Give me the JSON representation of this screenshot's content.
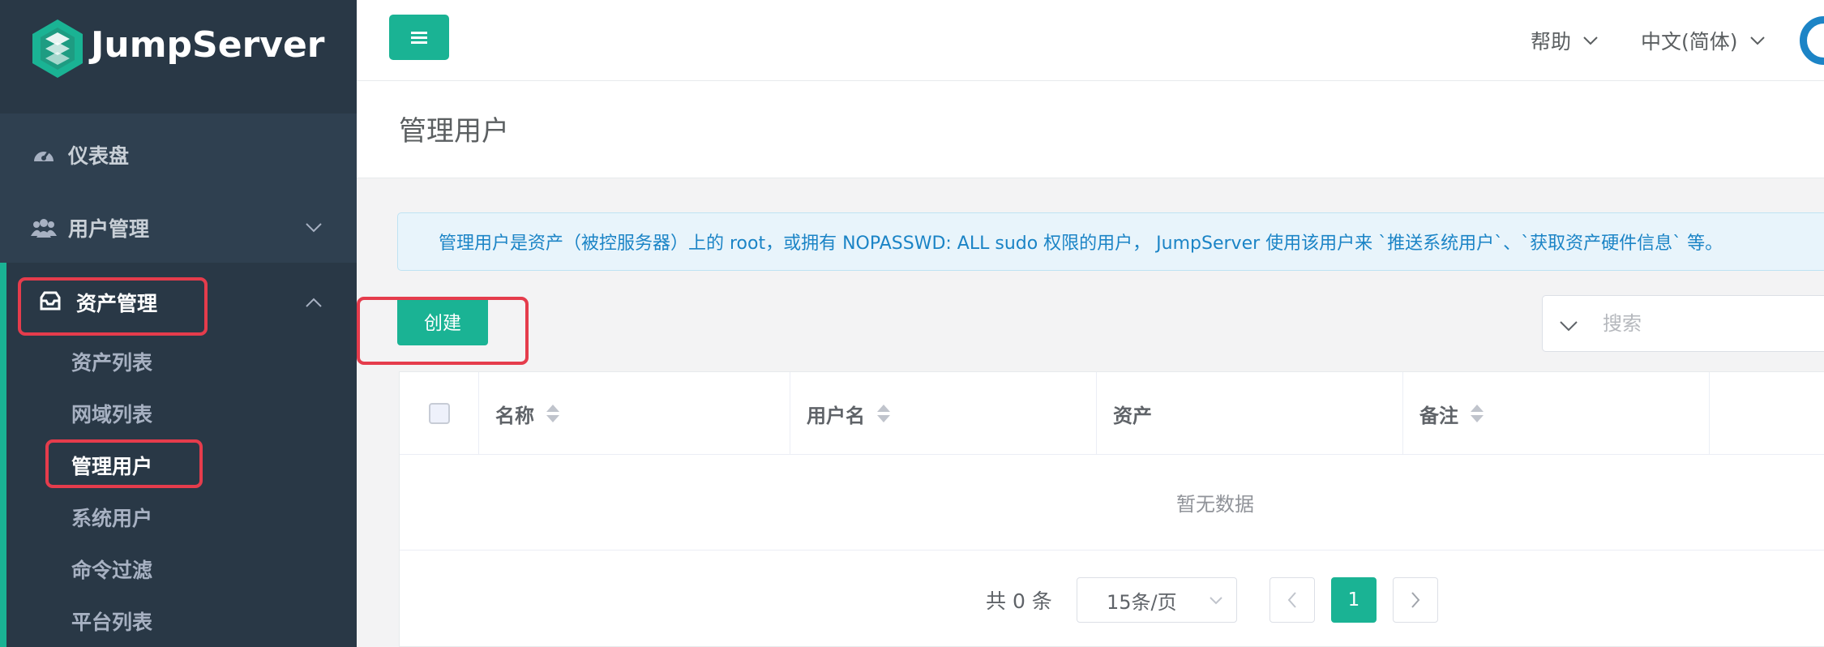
{
  "app": {
    "logo_text": "JumpServer"
  },
  "sidebar": {
    "dashboard_label": "仪表盘",
    "users_label": "用户管理",
    "assets_label": "资产管理",
    "assets_subitems": [
      "资产列表",
      "网域列表",
      "管理用户",
      "系统用户",
      "命令过滤",
      "平台列表"
    ],
    "active_subitem": "管理用户"
  },
  "topbar": {
    "help_label": "帮助",
    "language_label": "中文(简体)"
  },
  "page": {
    "title": "管理用户",
    "alert_text": "管理用户是资产（被控服务器）上的 root，或拥有 NOPASSWD: ALL sudo 权限的用户， JumpServer 使用该用户来 `推送系统用户`、`获取资产硬件信息` 等。",
    "create_label": "创建",
    "search_placeholder": "搜索"
  },
  "table": {
    "columns": [
      "名称",
      "用户名",
      "资产",
      "备注"
    ],
    "sortable": [
      true,
      true,
      false,
      true
    ],
    "rows": [],
    "empty_text": "暂无数据"
  },
  "pagination": {
    "total_text": "共 0 条",
    "page_size_label": "15条/页",
    "current_page": "1"
  },
  "colors": {
    "accent": "#1ab394",
    "sidebar_bg": "#2f4050",
    "info_text": "#1b84c6",
    "highlight_box": "#e53c4c"
  }
}
